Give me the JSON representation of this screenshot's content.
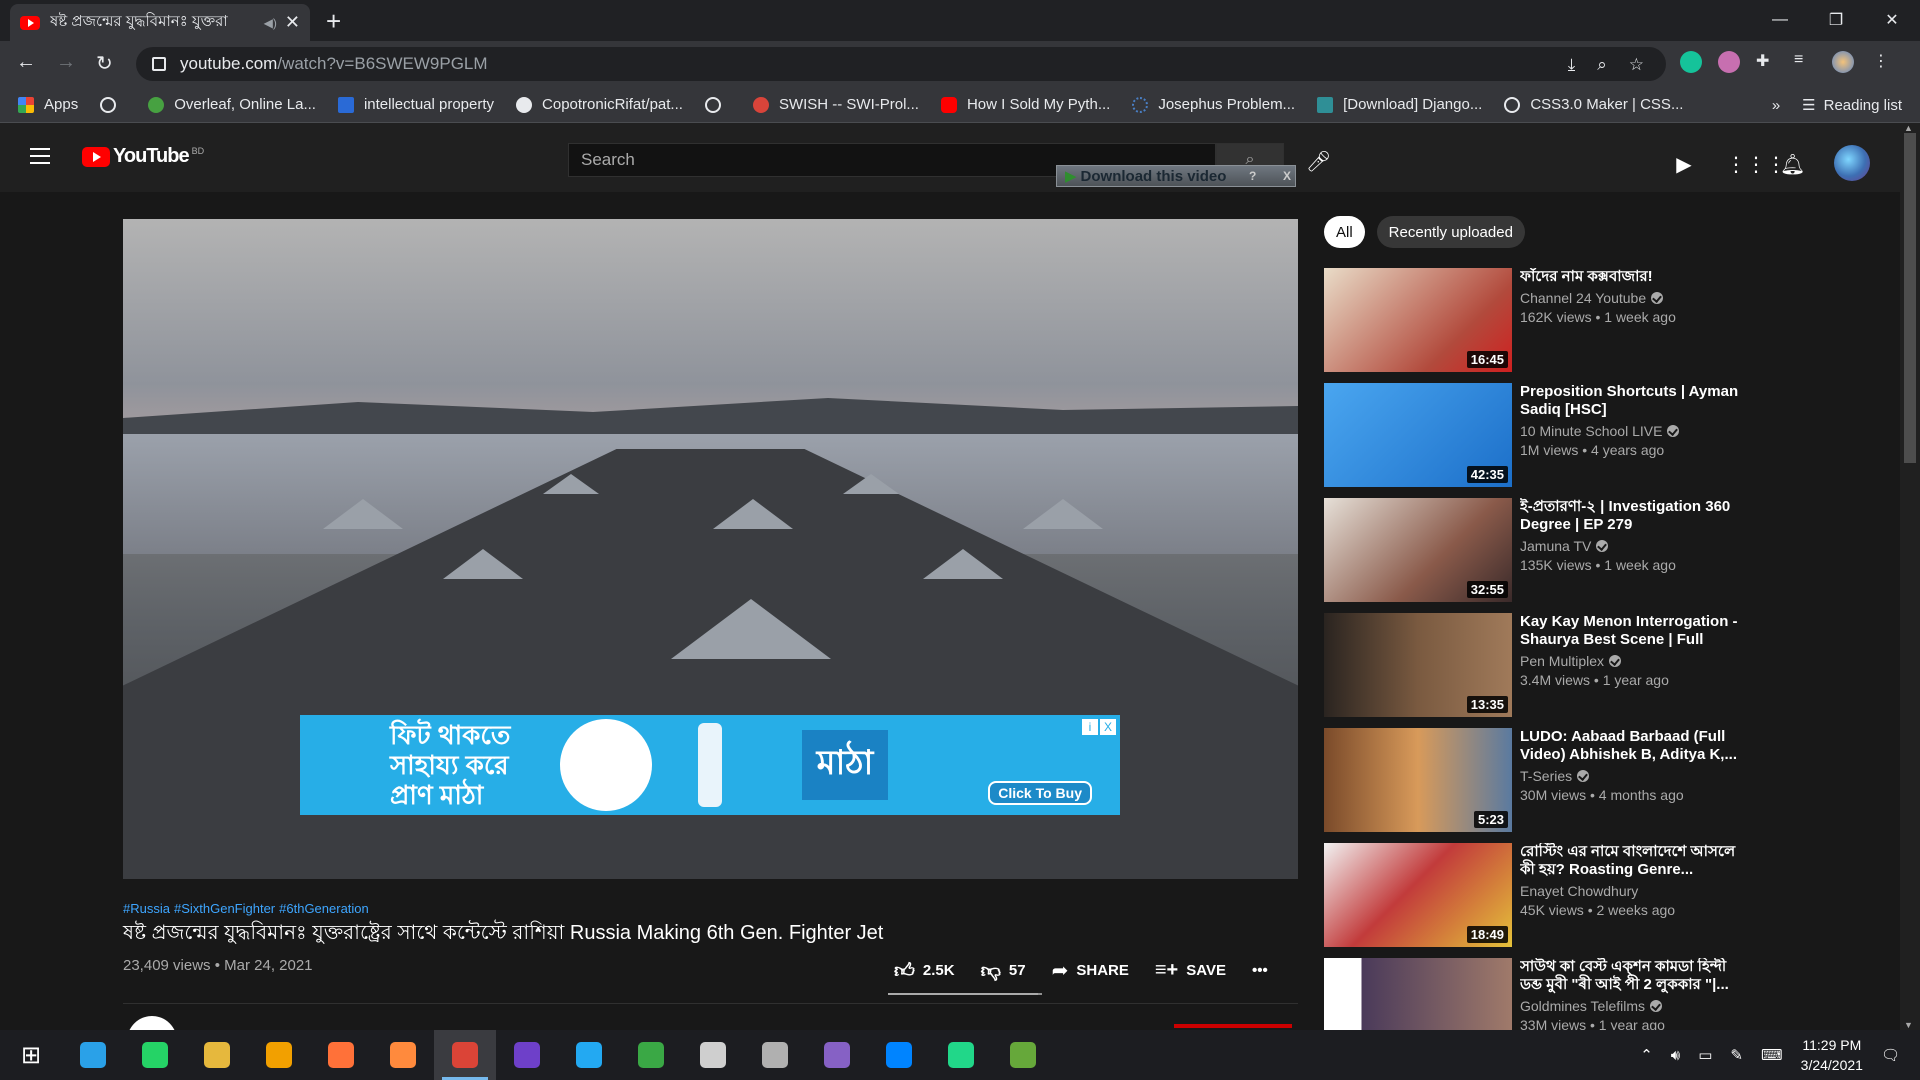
{
  "browser": {
    "tab_title": "ষষ্ট প্রজন্মের যুদ্ধবিমানঃ যুক্তরা",
    "new_tab": "+",
    "url_host": "youtube.com",
    "url_path": "/watch?v=B6SWEW9PGLM",
    "bookmarks": [
      {
        "label": "Apps",
        "color": "#ea4335"
      },
      {
        "label": "",
        "color": "#e8eaed"
      },
      {
        "label": "Overleaf, Online La...",
        "color": "#47a141"
      },
      {
        "label": "intellectual property",
        "color": "#2a6ad6"
      },
      {
        "label": "CopotronicRifat/pat...",
        "color": "#e8eaed"
      },
      {
        "label": "",
        "color": "#e8eaed"
      },
      {
        "label": "SWISH -- SWI-Prol...",
        "color": "#d9443a"
      },
      {
        "label": "How I Sold My Pyth...",
        "color": "#ff0000"
      },
      {
        "label": "Josephus Problem...",
        "color": "#4a7fc4"
      },
      {
        "label": "[Download] Django...",
        "color": "#2f8f96"
      },
      {
        "label": "CSS3.0 Maker | CSS...",
        "color": "#e8eaed"
      }
    ],
    "more_bookmarks": "»",
    "reading_list": "Reading list"
  },
  "youtube": {
    "logo_text": "YouTube",
    "country_code": "BD",
    "search_placeholder": "Search",
    "download_button": "Download this video",
    "download_help": "?",
    "download_close": "X"
  },
  "video": {
    "hashtags": [
      "#Russia",
      "#SixthGenFighter",
      "#6thGeneration"
    ],
    "title": "ষষ্ট প্রজন্মের যুদ্ধবিমানঃ যুক্তরাষ্ট্রের সাথে কন্টেস্টে রাশিয়া Russia Making 6th Gen. Fighter Jet",
    "views_date": "23,409 views • Mar 24, 2021",
    "likes": "2.5K",
    "dislikes": "57",
    "share": "SHARE",
    "save": "SAVE",
    "more": "•••",
    "like_ratio": 0.978
  },
  "ad": {
    "text": "ফিট থাকতে সাহায্য করে প্রাণ মাঠা",
    "brand": "মাঠা",
    "cta": "Click To Buy",
    "info": "i",
    "close": "X"
  },
  "sidebar": {
    "chips": [
      "All",
      "Recently uploaded"
    ],
    "recommendations": [
      {
        "title": "ফাঁদের নাম কক্সবাজার!",
        "channel": "Channel 24 Youtube",
        "meta": "162K views • 1 week ago",
        "duration": "16:45",
        "thumb": "#b24a3c"
      },
      {
        "title": "Preposition Shortcuts | Ayman Sadiq [HSC]",
        "channel": "10 Minute School LIVE",
        "meta": "1M views • 4 years ago",
        "duration": "42:35",
        "thumb": "#2a86e0"
      },
      {
        "title": "ই-প্রতারণা-২ | Investigation 360 Degree | EP 279",
        "channel": "Jamuna TV",
        "meta": "135K views • 1 week ago",
        "duration": "32:55",
        "thumb": "#8a5a4a"
      },
      {
        "title": "Kay Kay Menon Interrogation - Shaurya Best Scene | Full Hind...",
        "channel": "Pen Multiplex",
        "meta": "3.4M views • 1 year ago",
        "duration": "13:35",
        "thumb": "#5a4030"
      },
      {
        "title": "LUDO: Aabaad Barbaad (Full Video) Abhishek B, Aditya K,...",
        "channel": "T-Series",
        "meta": "30M views • 4 months ago",
        "duration": "5:23",
        "thumb": "#b46a3a"
      },
      {
        "title": "রোস্টিং এর নামে বাংলাদেশে আসলে কী হয়? Roasting Genre...",
        "channel": "Enayet Chowdhury",
        "meta": "45K views • 2 weeks ago",
        "duration": "18:49",
        "thumb": "#c23b3b"
      },
      {
        "title": "সাউথ কা বেস্ট এক্শন কামডা হিন্দী ডব্ড মুবী \"ৰী আই পী 2 লুককার \"|...",
        "channel": "Goldmines Telefilms",
        "meta": "33M views • 1 year ago",
        "duration": "",
        "thumb": "#4a3a5a"
      }
    ]
  },
  "taskbar": {
    "time": "11:29 PM",
    "date": "3/24/2021",
    "apps": [
      "#0078d7",
      "#2aa1e8",
      "#25d366",
      "#e6b83d",
      "#f2a000",
      "#ff7139",
      "#ff8a3d",
      "#db4437",
      "#6e40c9",
      "#23a9f2",
      "#3aa845",
      "#cfcfcf",
      "#b0b0b0",
      "#8661c5",
      "#0084ff",
      "#21d789",
      "#66a83a"
    ]
  }
}
